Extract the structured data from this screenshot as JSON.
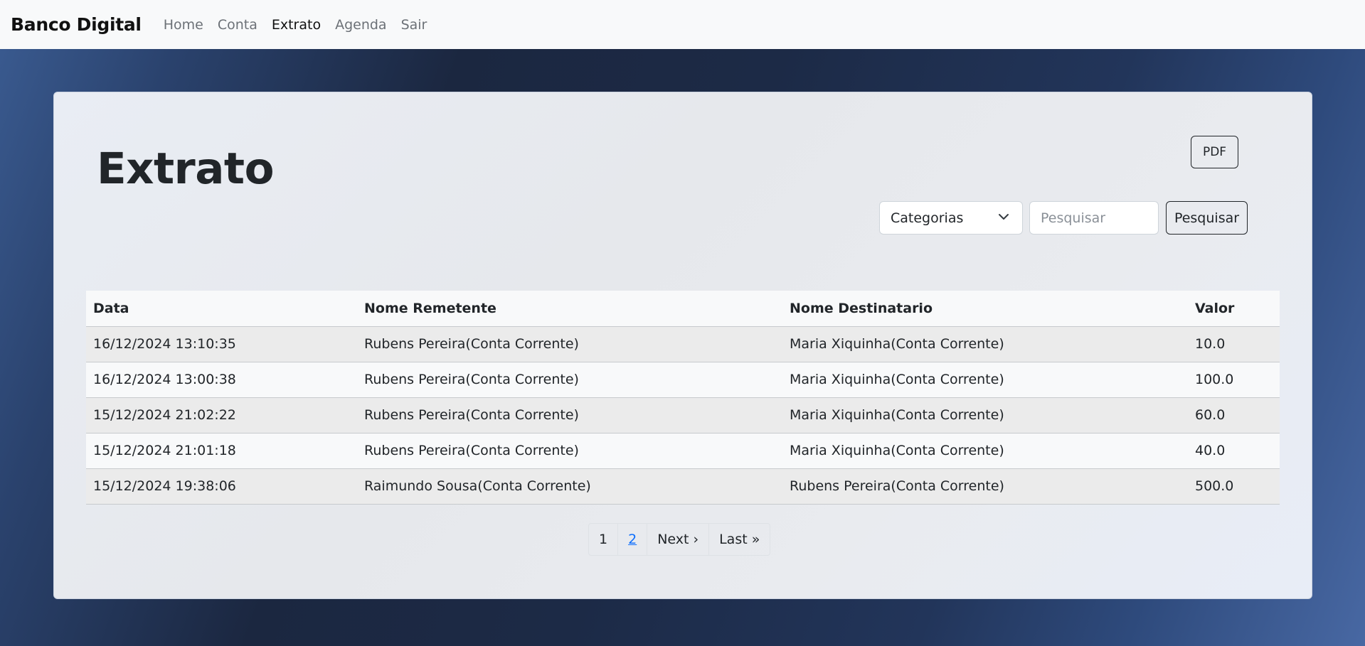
{
  "navbar": {
    "brand": "Banco Digital",
    "links": [
      "Home",
      "Conta",
      "Extrato",
      "Agenda",
      "Sair"
    ],
    "active": "Extrato"
  },
  "page": {
    "title": "Extrato",
    "pdf_label": "PDF",
    "category_select": "Categorias",
    "search_placeholder": "Pesquisar",
    "search_button": "Pesquisar"
  },
  "table": {
    "headers": [
      "Data",
      "Nome Remetente",
      "Nome Destinatario",
      "Valor"
    ],
    "rows": [
      [
        "16/12/2024 13:10:35",
        "Rubens Pereira(Conta Corrente)",
        "Maria Xiquinha(Conta Corrente)",
        "10.0"
      ],
      [
        "16/12/2024 13:00:38",
        "Rubens Pereira(Conta Corrente)",
        "Maria Xiquinha(Conta Corrente)",
        "100.0"
      ],
      [
        "15/12/2024 21:02:22",
        "Rubens Pereira(Conta Corrente)",
        "Maria Xiquinha(Conta Corrente)",
        "60.0"
      ],
      [
        "15/12/2024 21:01:18",
        "Rubens Pereira(Conta Corrente)",
        "Maria Xiquinha(Conta Corrente)",
        "40.0"
      ],
      [
        "15/12/2024 19:38:06",
        "Raimundo Sousa(Conta Corrente)",
        "Rubens Pereira(Conta Corrente)",
        "500.0"
      ]
    ]
  },
  "pagination": {
    "items": [
      "1",
      "2",
      "Next ›",
      "Last »"
    ]
  },
  "colors": {
    "navbar_bg": "#f8f9fa",
    "link_blue": "#0d6efd",
    "text_dark": "#212529"
  }
}
